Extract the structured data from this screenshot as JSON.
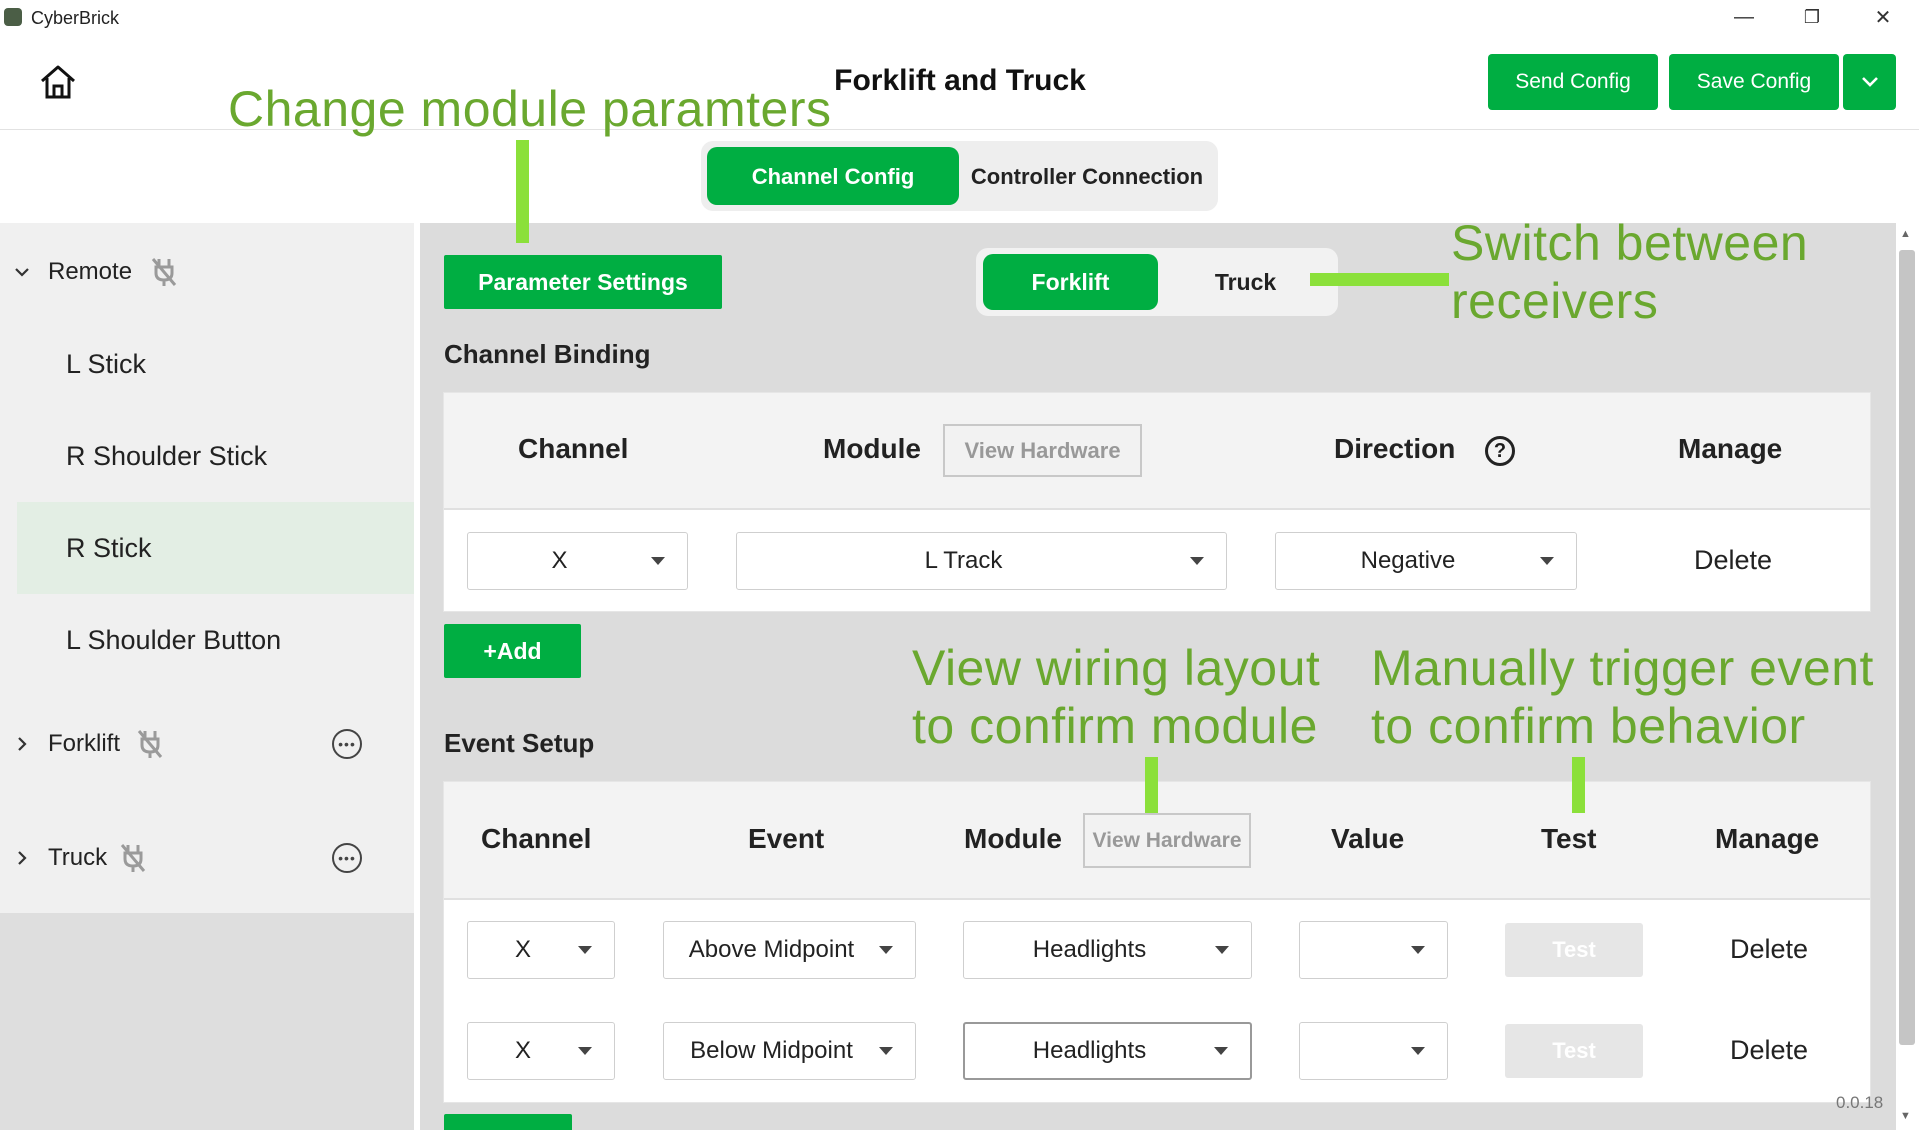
{
  "window": {
    "title": "CyberBrick",
    "controls": {
      "minimize": "—",
      "restore": "❐",
      "close": "✕"
    }
  },
  "header": {
    "title": "Forklift and Truck",
    "send_label": "Send Config",
    "save_label": "Save Config"
  },
  "tabs": [
    {
      "label": "Channel Config",
      "active": true
    },
    {
      "label": "Controller Connection",
      "active": false
    }
  ],
  "sidebar": {
    "groups": [
      {
        "label": "Remote",
        "expanded": true,
        "items": [
          "L Stick",
          "R Shoulder Stick",
          "R Stick",
          "L Shoulder Button"
        ],
        "selected": "R Stick"
      },
      {
        "label": "Forklift",
        "expanded": false
      },
      {
        "label": "Truck",
        "expanded": false
      }
    ]
  },
  "main": {
    "param_button": "Parameter Settings",
    "receivers": [
      {
        "label": "Forklift",
        "active": true
      },
      {
        "label": "Truck",
        "active": false
      }
    ],
    "binding": {
      "title": "Channel Binding",
      "headers": {
        "channel": "Channel",
        "module": "Module",
        "view_hw": "View Hardware",
        "direction": "Direction",
        "help": "?",
        "manage": "Manage"
      },
      "rows": [
        {
          "channel": "X",
          "module": "L Track",
          "direction": "Negative",
          "action": "Delete"
        }
      ],
      "add_label": "+Add"
    },
    "events": {
      "title": "Event Setup",
      "headers": {
        "channel": "Channel",
        "event": "Event",
        "module": "Module",
        "view_hw": "View Hardware",
        "value": "Value",
        "test": "Test",
        "manage": "Manage"
      },
      "rows": [
        {
          "channel": "X",
          "event": "Above Midpoint",
          "module": "Headlights",
          "value": "",
          "test": "Test",
          "action": "Delete"
        },
        {
          "channel": "X",
          "event": "Below Midpoint",
          "module": "Headlights",
          "value": "",
          "test": "Test",
          "action": "Delete"
        }
      ]
    }
  },
  "annotations": {
    "params": "Change module paramters",
    "receivers_l1": "Switch between",
    "receivers_l2": "receivers",
    "wiring_l1": "View wiring layout",
    "wiring_l2": "to confirm module",
    "trigger_l1": "Manually trigger event",
    "trigger_l2": "to confirm behavior"
  },
  "version": "0.0.18",
  "colors": {
    "accent": "#00ae42",
    "annotation_text": "#6aa82f",
    "annotation_line": "#8be03a"
  }
}
